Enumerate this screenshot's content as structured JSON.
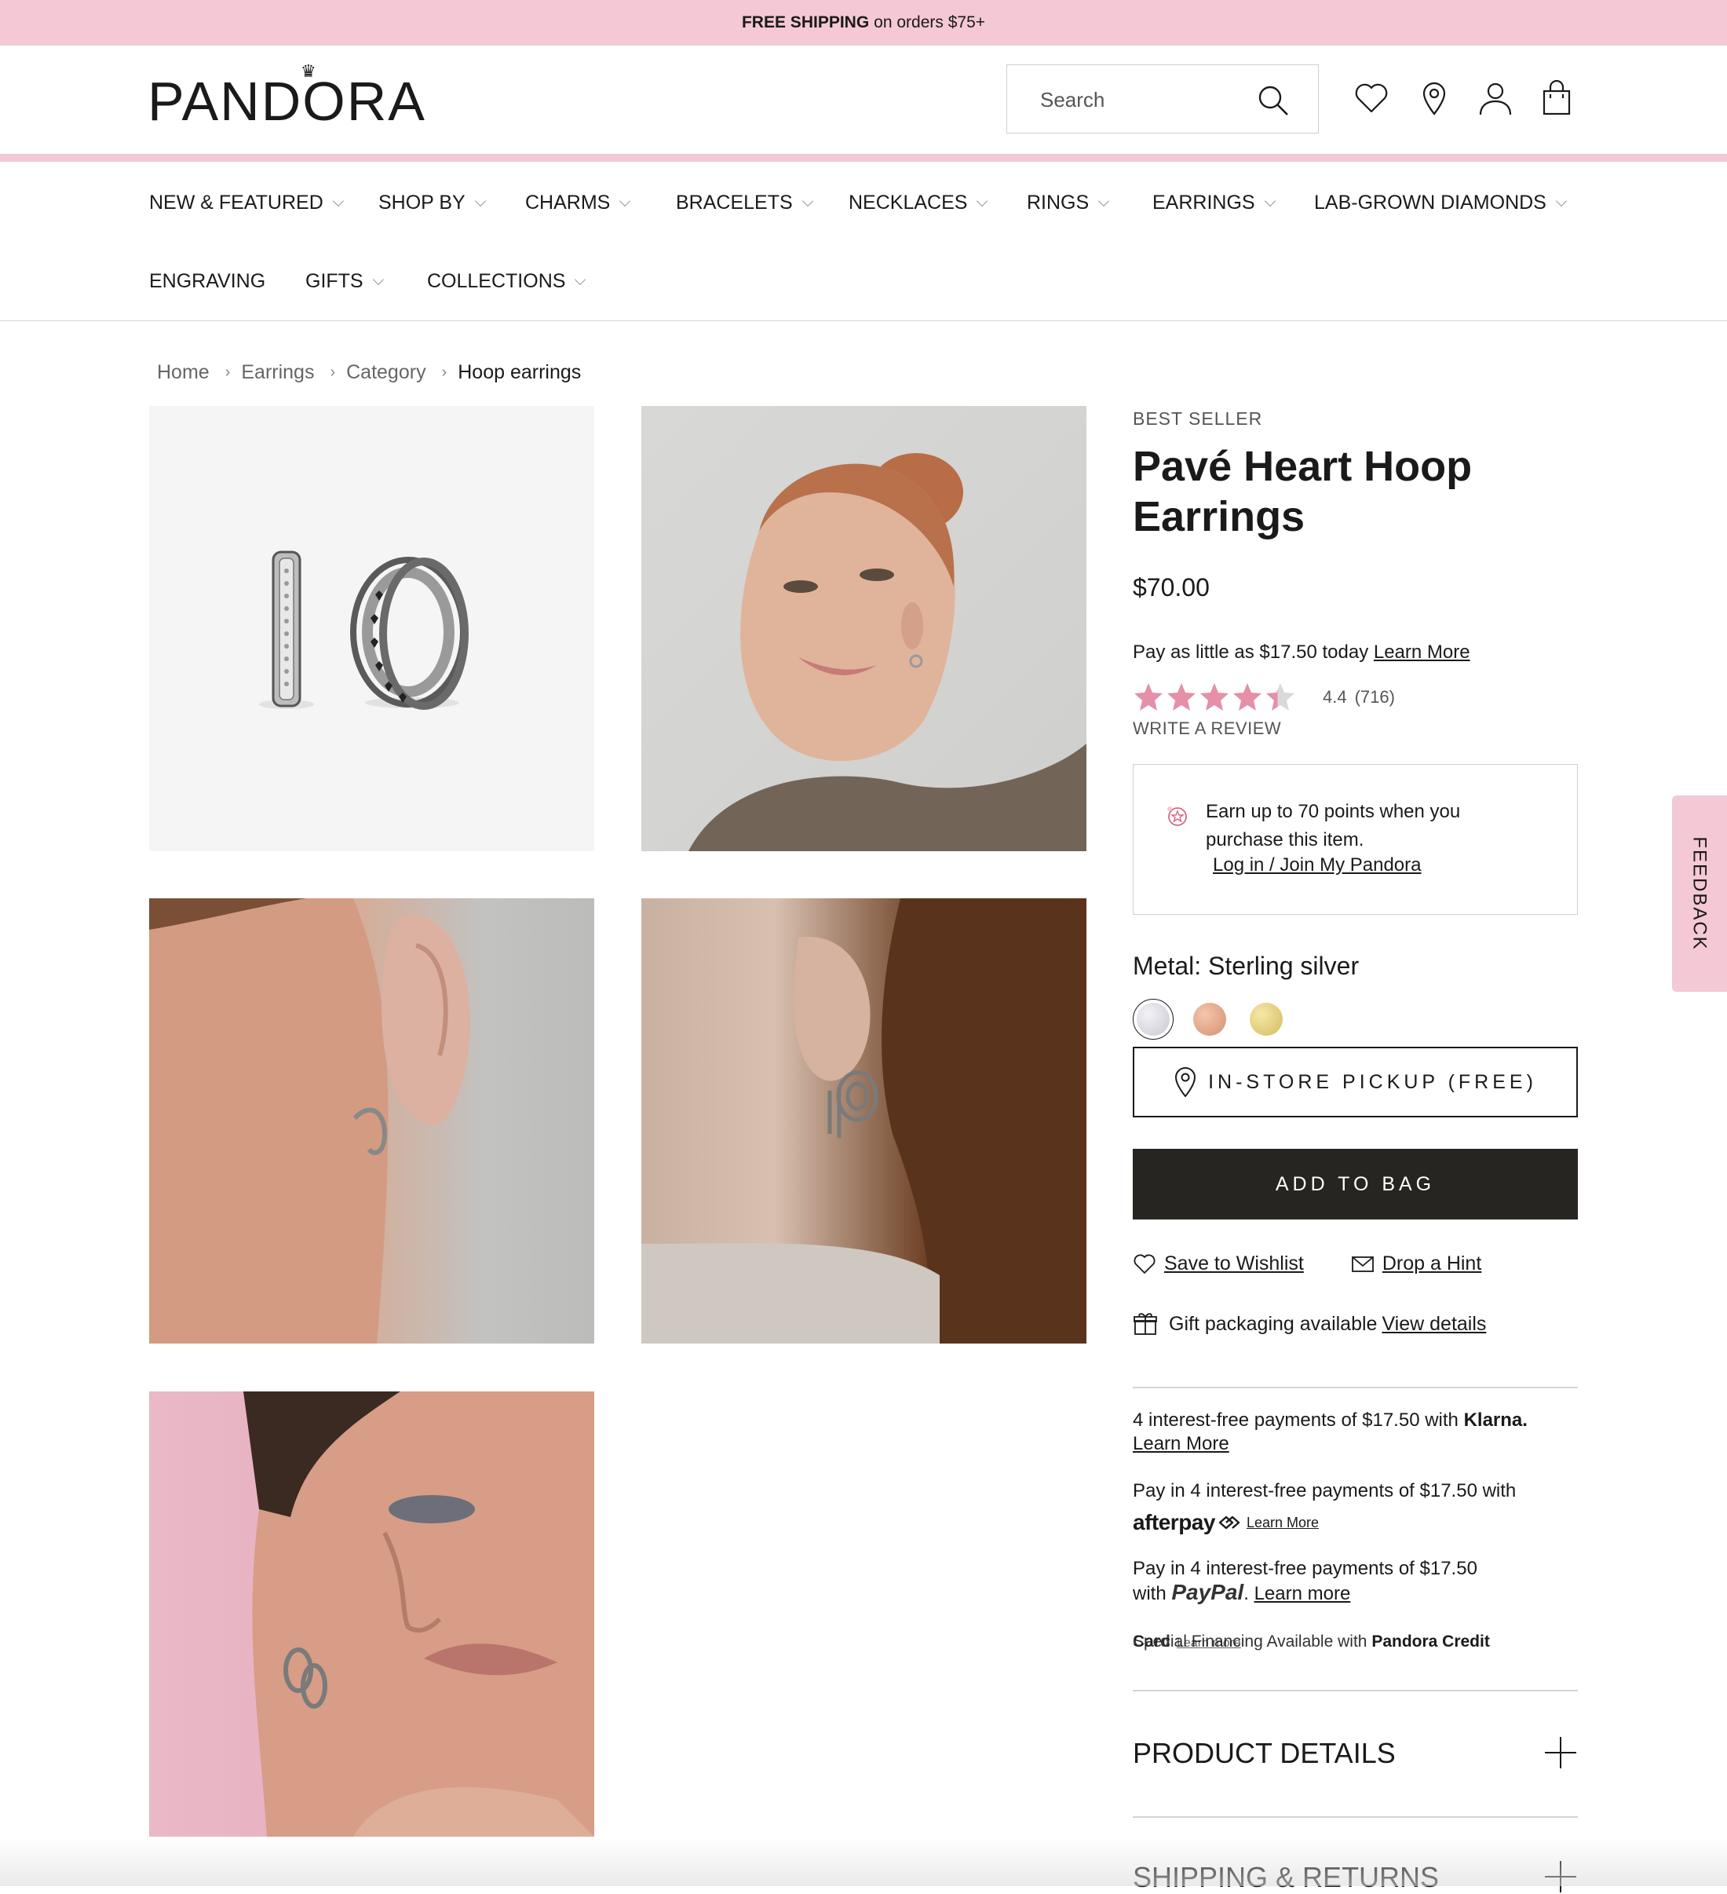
{
  "promo": {
    "bold": "FREE SHIPPING",
    "rest": "on orders $75+"
  },
  "header": {
    "logo": "PANDORA",
    "search_placeholder": "Search",
    "icons": [
      "heart-icon",
      "location-pin-icon",
      "account-icon",
      "bag-icon"
    ]
  },
  "nav": {
    "items": [
      {
        "label": "NEW & FEATURED",
        "dropdown": true
      },
      {
        "label": "SHOP BY",
        "dropdown": true
      },
      {
        "label": "CHARMS",
        "dropdown": true
      },
      {
        "label": "BRACELETS",
        "dropdown": true
      },
      {
        "label": "NECKLACES",
        "dropdown": true
      },
      {
        "label": "RINGS",
        "dropdown": true
      },
      {
        "label": "EARRINGS",
        "dropdown": true
      },
      {
        "label": "LAB-GROWN DIAMONDS",
        "dropdown": true
      },
      {
        "label": "ENGRAVING",
        "dropdown": false
      },
      {
        "label": "GIFTS",
        "dropdown": true
      },
      {
        "label": "COLLECTIONS",
        "dropdown": true
      }
    ]
  },
  "breadcrumb": [
    "Home",
    "Earrings",
    "Category",
    "Hoop earrings"
  ],
  "product": {
    "eyebrow": "BEST SELLER",
    "title": "Pavé Heart Hoop Earrings",
    "price": "$70.00",
    "pay_little_text": "Pay as little as $17.50 today",
    "pay_little_link": "Learn More",
    "rating": {
      "value": "4.4",
      "count": "(716)",
      "stars": 4.4,
      "max": 5
    },
    "write_review": "WRITE A REVIEW",
    "points": {
      "text": "Earn up to 70 points when you purchase this item.",
      "link": "Log in / Join My Pandora"
    },
    "metal_label": "Metal: Sterling silver",
    "swatches": [
      {
        "name": "Sterling silver",
        "color": "#d9d9e0",
        "selected": true
      },
      {
        "name": "Rose gold",
        "color": "#e3a98c",
        "selected": false
      },
      {
        "name": "Gold",
        "color": "#e3cf7d",
        "selected": false
      }
    ],
    "pickup_button": "IN-STORE PICKUP (FREE)",
    "add_to_bag": "ADD TO BAG",
    "wishlist": "Save to Wishlist",
    "hint": "Drop a Hint",
    "gift_text": "Gift packaging available",
    "gift_link": "View details"
  },
  "payments": {
    "klarna_text": "4 interest-free payments of $17.50 with",
    "klarna_brand": "Klarna.",
    "klarna_link": "Learn More",
    "afterpay_text": "Pay in 4 interest-free payments of $17.50 with",
    "afterpay_brand": "afterpay",
    "afterpay_link": "Learn More",
    "paypal_text_1": "Pay in 4 interest-free payments of $17.50",
    "paypal_text_2": "with",
    "paypal_brand": "PayPal",
    "paypal_link": "Learn more",
    "credit_text": "Special Financing Available with",
    "credit_brand": "Pandora Credit",
    "credit_overlap": "Card",
    "credit_overlap_link": "Learn more"
  },
  "accordions": [
    "PRODUCT DETAILS",
    "SHIPPING & RETURNS"
  ],
  "feedback": "FEEDBACK",
  "colors": {
    "brand_pink": "#f4c8d4",
    "dark_button": "#262522",
    "star_pink": "#e58fa8"
  }
}
